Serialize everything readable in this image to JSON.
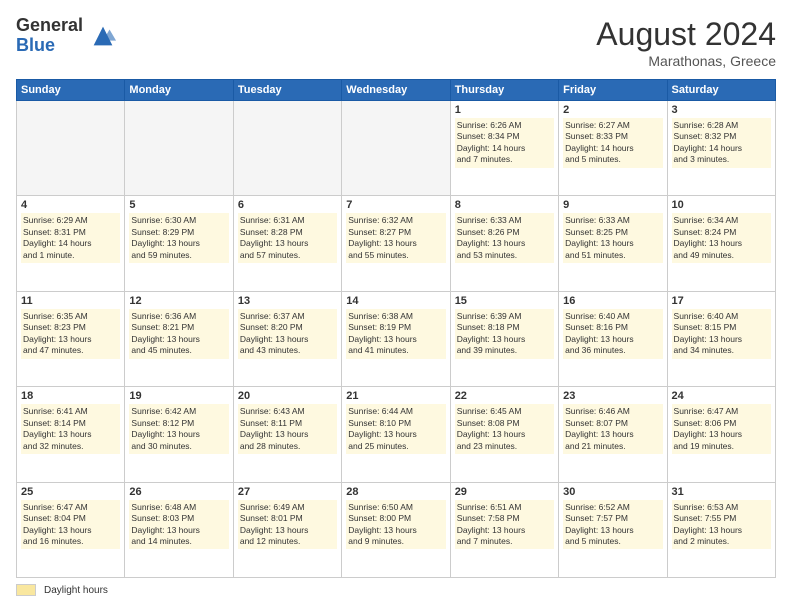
{
  "header": {
    "logo_general": "General",
    "logo_blue": "Blue",
    "month_year": "August 2024",
    "location": "Marathonas, Greece"
  },
  "footer": {
    "legend_label": "Daylight hours"
  },
  "days_of_week": [
    "Sunday",
    "Monday",
    "Tuesday",
    "Wednesday",
    "Thursday",
    "Friday",
    "Saturday"
  ],
  "weeks": [
    [
      {
        "num": "",
        "info": ""
      },
      {
        "num": "",
        "info": ""
      },
      {
        "num": "",
        "info": ""
      },
      {
        "num": "",
        "info": ""
      },
      {
        "num": "1",
        "info": "Sunrise: 6:26 AM\nSunset: 8:34 PM\nDaylight: 14 hours\nand 7 minutes."
      },
      {
        "num": "2",
        "info": "Sunrise: 6:27 AM\nSunset: 8:33 PM\nDaylight: 14 hours\nand 5 minutes."
      },
      {
        "num": "3",
        "info": "Sunrise: 6:28 AM\nSunset: 8:32 PM\nDaylight: 14 hours\nand 3 minutes."
      }
    ],
    [
      {
        "num": "4",
        "info": "Sunrise: 6:29 AM\nSunset: 8:31 PM\nDaylight: 14 hours\nand 1 minute."
      },
      {
        "num": "5",
        "info": "Sunrise: 6:30 AM\nSunset: 8:29 PM\nDaylight: 13 hours\nand 59 minutes."
      },
      {
        "num": "6",
        "info": "Sunrise: 6:31 AM\nSunset: 8:28 PM\nDaylight: 13 hours\nand 57 minutes."
      },
      {
        "num": "7",
        "info": "Sunrise: 6:32 AM\nSunset: 8:27 PM\nDaylight: 13 hours\nand 55 minutes."
      },
      {
        "num": "8",
        "info": "Sunrise: 6:33 AM\nSunset: 8:26 PM\nDaylight: 13 hours\nand 53 minutes."
      },
      {
        "num": "9",
        "info": "Sunrise: 6:33 AM\nSunset: 8:25 PM\nDaylight: 13 hours\nand 51 minutes."
      },
      {
        "num": "10",
        "info": "Sunrise: 6:34 AM\nSunset: 8:24 PM\nDaylight: 13 hours\nand 49 minutes."
      }
    ],
    [
      {
        "num": "11",
        "info": "Sunrise: 6:35 AM\nSunset: 8:23 PM\nDaylight: 13 hours\nand 47 minutes."
      },
      {
        "num": "12",
        "info": "Sunrise: 6:36 AM\nSunset: 8:21 PM\nDaylight: 13 hours\nand 45 minutes."
      },
      {
        "num": "13",
        "info": "Sunrise: 6:37 AM\nSunset: 8:20 PM\nDaylight: 13 hours\nand 43 minutes."
      },
      {
        "num": "14",
        "info": "Sunrise: 6:38 AM\nSunset: 8:19 PM\nDaylight: 13 hours\nand 41 minutes."
      },
      {
        "num": "15",
        "info": "Sunrise: 6:39 AM\nSunset: 8:18 PM\nDaylight: 13 hours\nand 39 minutes."
      },
      {
        "num": "16",
        "info": "Sunrise: 6:40 AM\nSunset: 8:16 PM\nDaylight: 13 hours\nand 36 minutes."
      },
      {
        "num": "17",
        "info": "Sunrise: 6:40 AM\nSunset: 8:15 PM\nDaylight: 13 hours\nand 34 minutes."
      }
    ],
    [
      {
        "num": "18",
        "info": "Sunrise: 6:41 AM\nSunset: 8:14 PM\nDaylight: 13 hours\nand 32 minutes."
      },
      {
        "num": "19",
        "info": "Sunrise: 6:42 AM\nSunset: 8:12 PM\nDaylight: 13 hours\nand 30 minutes."
      },
      {
        "num": "20",
        "info": "Sunrise: 6:43 AM\nSunset: 8:11 PM\nDaylight: 13 hours\nand 28 minutes."
      },
      {
        "num": "21",
        "info": "Sunrise: 6:44 AM\nSunset: 8:10 PM\nDaylight: 13 hours\nand 25 minutes."
      },
      {
        "num": "22",
        "info": "Sunrise: 6:45 AM\nSunset: 8:08 PM\nDaylight: 13 hours\nand 23 minutes."
      },
      {
        "num": "23",
        "info": "Sunrise: 6:46 AM\nSunset: 8:07 PM\nDaylight: 13 hours\nand 21 minutes."
      },
      {
        "num": "24",
        "info": "Sunrise: 6:47 AM\nSunset: 8:06 PM\nDaylight: 13 hours\nand 19 minutes."
      }
    ],
    [
      {
        "num": "25",
        "info": "Sunrise: 6:47 AM\nSunset: 8:04 PM\nDaylight: 13 hours\nand 16 minutes."
      },
      {
        "num": "26",
        "info": "Sunrise: 6:48 AM\nSunset: 8:03 PM\nDaylight: 13 hours\nand 14 minutes."
      },
      {
        "num": "27",
        "info": "Sunrise: 6:49 AM\nSunset: 8:01 PM\nDaylight: 13 hours\nand 12 minutes."
      },
      {
        "num": "28",
        "info": "Sunrise: 6:50 AM\nSunset: 8:00 PM\nDaylight: 13 hours\nand 9 minutes."
      },
      {
        "num": "29",
        "info": "Sunrise: 6:51 AM\nSunset: 7:58 PM\nDaylight: 13 hours\nand 7 minutes."
      },
      {
        "num": "30",
        "info": "Sunrise: 6:52 AM\nSunset: 7:57 PM\nDaylight: 13 hours\nand 5 minutes."
      },
      {
        "num": "31",
        "info": "Sunrise: 6:53 AM\nSunset: 7:55 PM\nDaylight: 13 hours\nand 2 minutes."
      }
    ]
  ]
}
